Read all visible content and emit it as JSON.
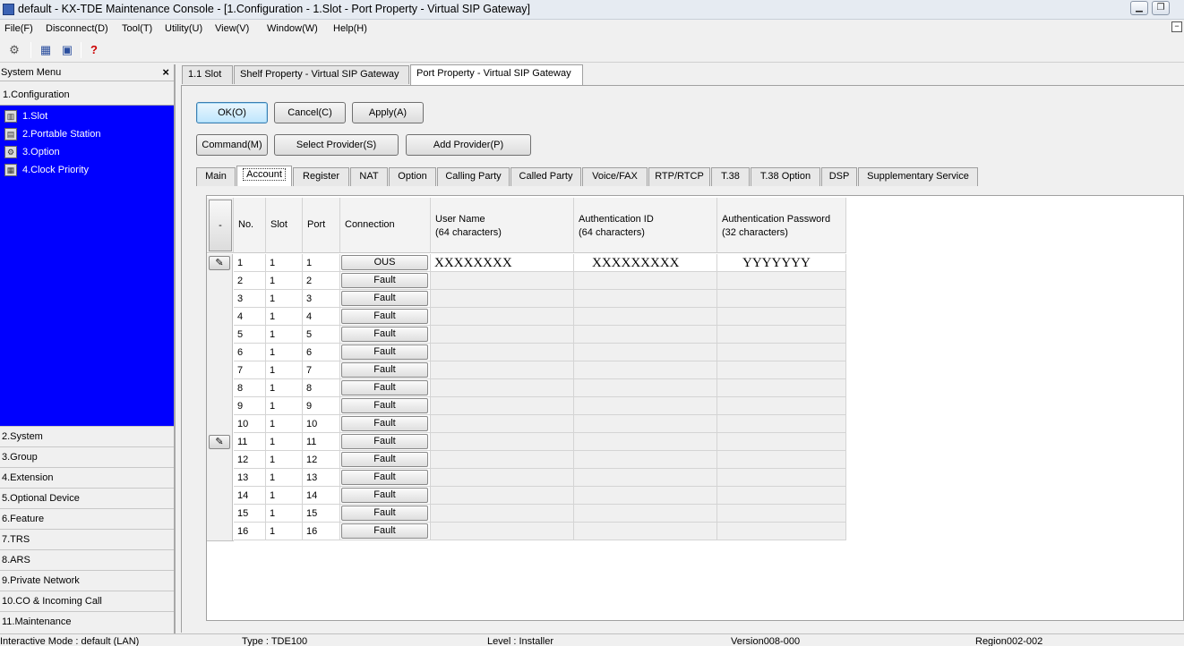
{
  "window": {
    "title": "default - KX-TDE Maintenance Console - [1.Configuration - 1.Slot - Port Property - Virtual SIP Gateway]"
  },
  "menu": [
    "File(F)",
    "Disconnect(D)",
    "Tool(T)",
    "Utility(U)",
    "View(V)",
    "Window(W)",
    "Help(H)"
  ],
  "sidebar": {
    "header": "System Menu",
    "expanded": "1.Configuration",
    "config_items": [
      "1.Slot",
      "2.Portable Station",
      "3.Option",
      "4.Clock Priority"
    ],
    "sections": [
      "2.System",
      "3.Group",
      "4.Extension",
      "5.Optional Device",
      "6.Feature",
      "7.TRS",
      "8.ARS",
      "9.Private Network",
      "10.CO & Incoming Call",
      "11.Maintenance"
    ]
  },
  "doc_tabs": [
    "1.1 Slot",
    "Shelf Property - Virtual SIP Gateway",
    "Port Property - Virtual SIP Gateway"
  ],
  "buttons": {
    "ok": "OK(O)",
    "cancel": "Cancel(C)",
    "apply": "Apply(A)",
    "command": "Command(M)",
    "select_provider": "Select Provider(S)",
    "add_provider": "Add Provider(P)"
  },
  "tabs": [
    "Main",
    "Account",
    "Register",
    "NAT",
    "Option",
    "Calling Party",
    "Called Party",
    "Voice/FAX",
    "RTP/RTCP",
    "T.38",
    "T.38 Option",
    "DSP",
    "Supplementary Service"
  ],
  "selected_tab": "Account",
  "grid": {
    "corner": "-",
    "headers": {
      "no": "No.",
      "slot": "Slot",
      "port": "Port",
      "connection": "Connection",
      "user_name": "User Name",
      "user_name_sub": "(64 characters)",
      "auth_id": "Authentication ID",
      "auth_id_sub": "(64 characters)",
      "auth_pw": "Authentication Password",
      "auth_pw_sub": "(32 characters)"
    },
    "rows": [
      {
        "no": "1",
        "slot": "1",
        "port": "1",
        "connection": "OUS",
        "user": "XXXXXXXX",
        "auth_id": "XXXXXXXXX",
        "auth_pw": "YYYYYYY"
      },
      {
        "no": "2",
        "slot": "1",
        "port": "2",
        "connection": "Fault",
        "user": "",
        "auth_id": "",
        "auth_pw": ""
      },
      {
        "no": "3",
        "slot": "1",
        "port": "3",
        "connection": "Fault",
        "user": "",
        "auth_id": "",
        "auth_pw": ""
      },
      {
        "no": "4",
        "slot": "1",
        "port": "4",
        "connection": "Fault",
        "user": "",
        "auth_id": "",
        "auth_pw": ""
      },
      {
        "no": "5",
        "slot": "1",
        "port": "5",
        "connection": "Fault",
        "user": "",
        "auth_id": "",
        "auth_pw": ""
      },
      {
        "no": "6",
        "slot": "1",
        "port": "6",
        "connection": "Fault",
        "user": "",
        "auth_id": "",
        "auth_pw": ""
      },
      {
        "no": "7",
        "slot": "1",
        "port": "7",
        "connection": "Fault",
        "user": "",
        "auth_id": "",
        "auth_pw": ""
      },
      {
        "no": "8",
        "slot": "1",
        "port": "8",
        "connection": "Fault",
        "user": "",
        "auth_id": "",
        "auth_pw": ""
      },
      {
        "no": "9",
        "slot": "1",
        "port": "9",
        "connection": "Fault",
        "user": "",
        "auth_id": "",
        "auth_pw": ""
      },
      {
        "no": "10",
        "slot": "1",
        "port": "10",
        "connection": "Fault",
        "user": "",
        "auth_id": "",
        "auth_pw": ""
      },
      {
        "no": "11",
        "slot": "1",
        "port": "11",
        "connection": "Fault",
        "user": "",
        "auth_id": "",
        "auth_pw": ""
      },
      {
        "no": "12",
        "slot": "1",
        "port": "12",
        "connection": "Fault",
        "user": "",
        "auth_id": "",
        "auth_pw": ""
      },
      {
        "no": "13",
        "slot": "1",
        "port": "13",
        "connection": "Fault",
        "user": "",
        "auth_id": "",
        "auth_pw": ""
      },
      {
        "no": "14",
        "slot": "1",
        "port": "14",
        "connection": "Fault",
        "user": "",
        "auth_id": "",
        "auth_pw": ""
      },
      {
        "no": "15",
        "slot": "1",
        "port": "15",
        "connection": "Fault",
        "user": "",
        "auth_id": "",
        "auth_pw": ""
      },
      {
        "no": "16",
        "slot": "1",
        "port": "16",
        "connection": "Fault",
        "user": "",
        "auth_id": "",
        "auth_pw": ""
      }
    ]
  },
  "status": {
    "mode": "Interactive Mode : default (LAN)",
    "type": "Type : TDE100",
    "level": "Level : Installer",
    "version": "Version008-000",
    "region": "Region002-002"
  },
  "colors": {
    "sidebar_selected_bg": "#0000ff",
    "sidebar_selected_fg": "#ffffff"
  }
}
